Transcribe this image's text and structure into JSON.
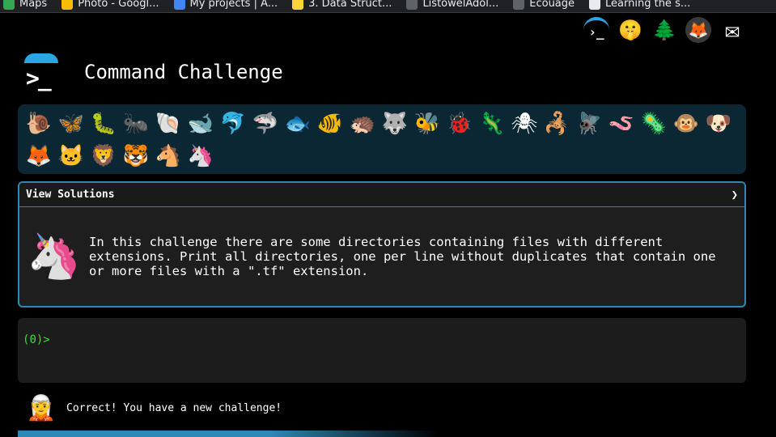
{
  "bookmarks": [
    {
      "label": "Maps",
      "color": "#34a853"
    },
    {
      "label": "Photo - Googl...",
      "color": "#fbbc05"
    },
    {
      "label": "My projects | A...",
      "color": "#4285f4"
    },
    {
      "label": "3. Data Struct...",
      "color": "#ffd43b"
    },
    {
      "label": "ListowelAdol...",
      "color": "#5f6368"
    },
    {
      "label": "Ecouage",
      "color": "#5f6368"
    },
    {
      "label": "Learning the s...",
      "color": "#e8eaed"
    }
  ],
  "top_icons": [
    {
      "name": "command-challenge-logo-icon",
      "glyph": "›_"
    },
    {
      "name": "shushing-face-icon",
      "glyph": "🤫"
    },
    {
      "name": "evergreen-tree-icon",
      "glyph": "🌲"
    },
    {
      "name": "gitlab-icon",
      "glyph": "🦊"
    },
    {
      "name": "envelope-icon",
      "glyph": "✉"
    }
  ],
  "header": {
    "title": "Command Challenge",
    "logo_glyph": ">_"
  },
  "animals": [
    {
      "name": "snail-icon",
      "glyph": "🐌"
    },
    {
      "name": "butterfly-icon",
      "glyph": "🦋"
    },
    {
      "name": "caterpillar-icon",
      "glyph": "🐛"
    },
    {
      "name": "ant-icon",
      "glyph": "🐜"
    },
    {
      "name": "shell-icon",
      "glyph": "🐚"
    },
    {
      "name": "whale-icon",
      "glyph": "🐋"
    },
    {
      "name": "dolphin-icon",
      "glyph": "🐬"
    },
    {
      "name": "shark-icon",
      "glyph": "🦈"
    },
    {
      "name": "fish-icon",
      "glyph": "🐟"
    },
    {
      "name": "tropical-fish-icon",
      "glyph": "🐠"
    },
    {
      "name": "hedgehog-icon",
      "glyph": "🦔"
    },
    {
      "name": "wolf-icon",
      "glyph": "🐺"
    },
    {
      "name": "bee-icon",
      "glyph": "🐝"
    },
    {
      "name": "ladybug-icon",
      "glyph": "🐞"
    },
    {
      "name": "lizard-icon",
      "glyph": "🦎"
    },
    {
      "name": "spider-icon",
      "glyph": "🕷"
    },
    {
      "name": "scorpion-icon",
      "glyph": "🦂"
    },
    {
      "name": "fly-icon",
      "glyph": "🪰"
    },
    {
      "name": "worm-icon",
      "glyph": "🪱"
    },
    {
      "name": "microbe-icon",
      "glyph": "🦠"
    },
    {
      "name": "monkey-icon",
      "glyph": "🐵"
    },
    {
      "name": "dog-icon",
      "glyph": "🐶"
    },
    {
      "name": "fox-icon",
      "glyph": "🦊"
    },
    {
      "name": "cat-icon",
      "glyph": "🐱"
    },
    {
      "name": "lion-icon",
      "glyph": "🦁"
    },
    {
      "name": "tiger-icon",
      "glyph": "🐯"
    },
    {
      "name": "horse-icon",
      "glyph": "🐴"
    },
    {
      "name": "unicorn-icon",
      "glyph": "🦄"
    }
  ],
  "solutions_panel": {
    "heading": "View Solutions",
    "chevron": "❯",
    "mascot_glyph": "🦄",
    "challenge_text": "In this challenge there are some directories containing files with different extensions. Print all directories, one per line without duplicates that contain one or more files with a \".tf\" extension."
  },
  "terminal": {
    "prompt_open": "(",
    "prompt_code": "0",
    "prompt_close": ")>"
  },
  "status": {
    "mascot_glyph": "🧝",
    "message": "Correct! You have a new challenge!"
  },
  "colors": {
    "panel_border": "#2d88b4",
    "animal_strip_bg": "#0b2733",
    "prompt_green": "#2fe22f"
  }
}
